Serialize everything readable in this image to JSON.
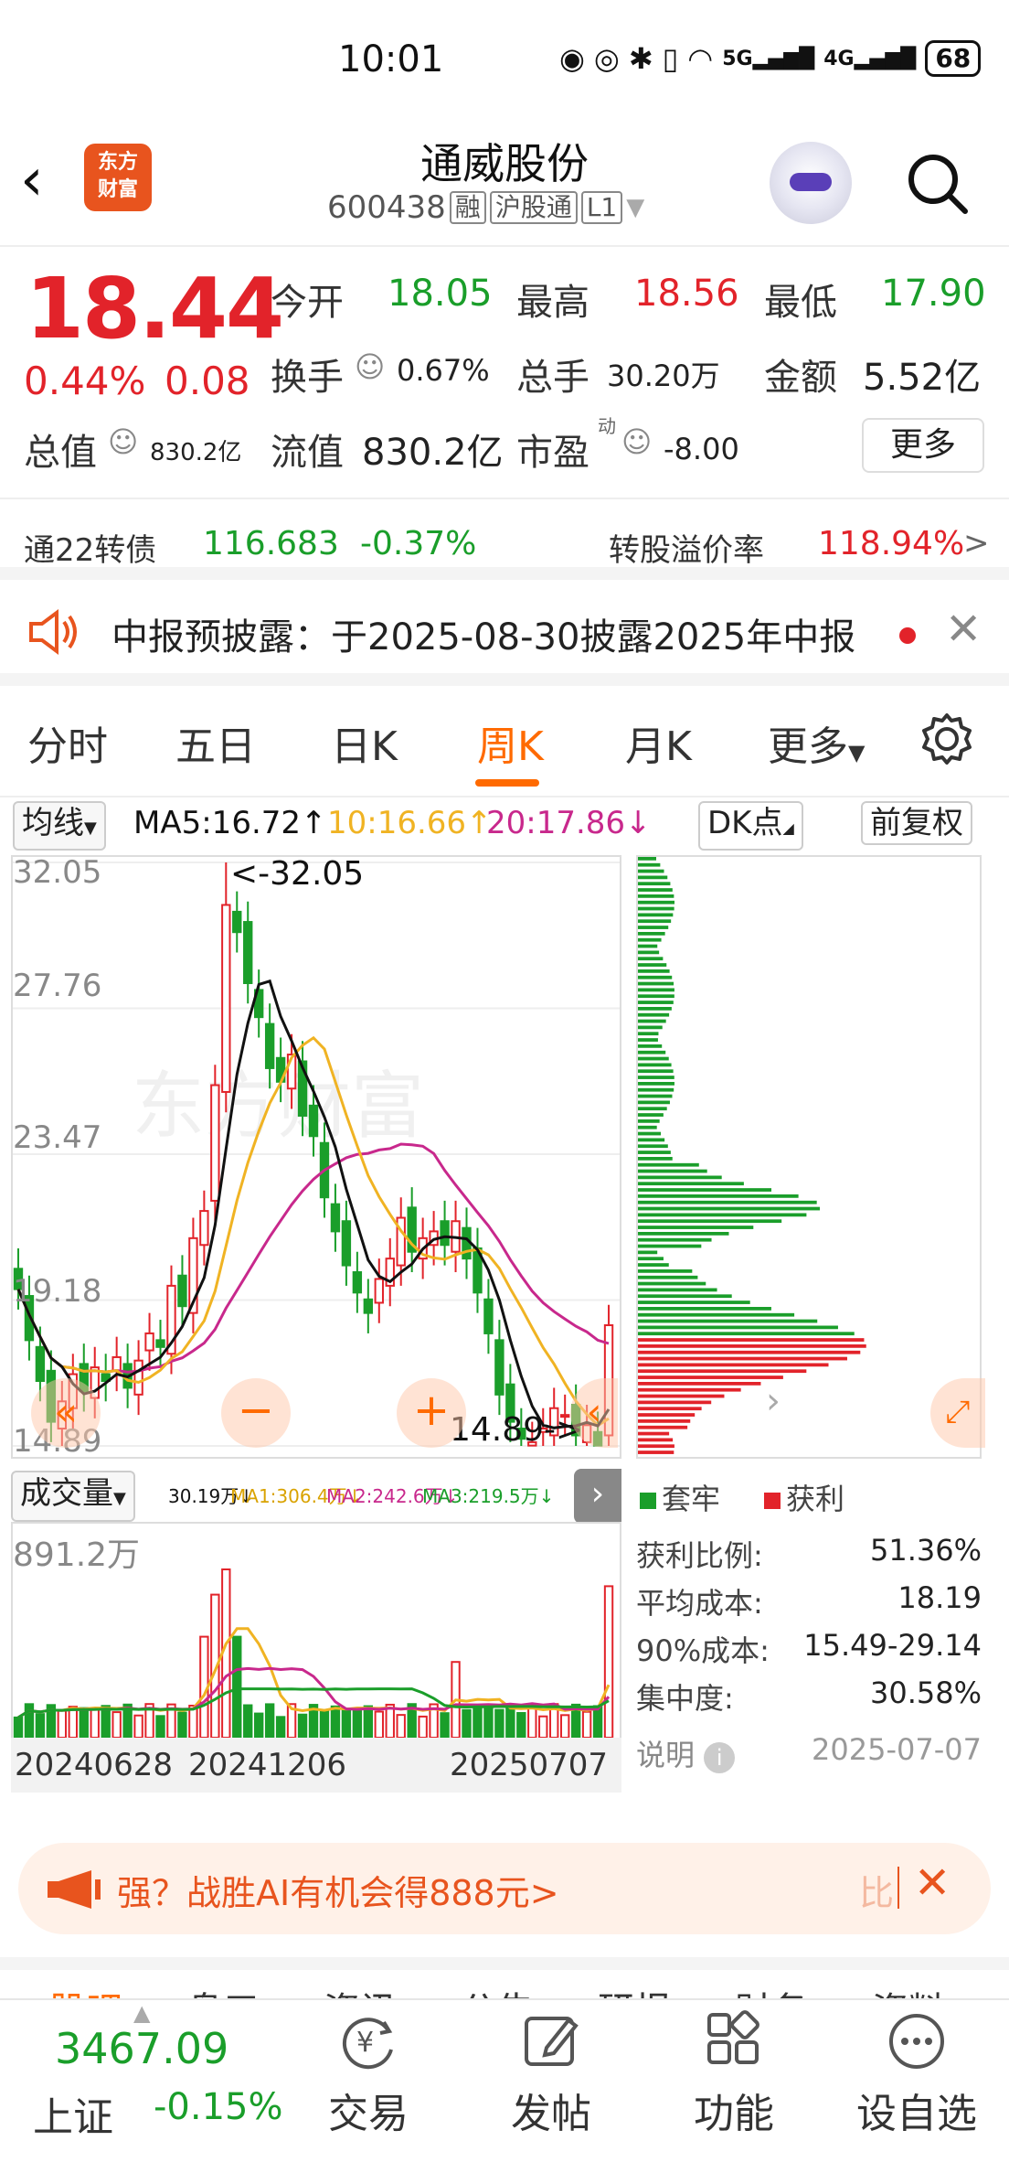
{
  "status_bar": {
    "time": "10:01",
    "network": "5G",
    "network2": "4G",
    "battery": "68"
  },
  "header": {
    "title": "通威股份",
    "code": "600438",
    "tags": [
      "融",
      "沪股通",
      "L1"
    ],
    "logo_text": "东方财富"
  },
  "quote": {
    "price": "18.44",
    "change_pct": "0.44%",
    "change_val": "0.08",
    "open_label": "今开",
    "open": "18.05",
    "high_label": "最高",
    "high": "18.56",
    "low_label": "最低",
    "low": "17.90",
    "turnover_label": "换手",
    "turnover": "0.67%",
    "volume_label": "总手",
    "volume": "30.20万",
    "amount_label": "金额",
    "amount": "5.52亿",
    "total_cap_label": "总值",
    "total_cap": "830.2亿",
    "float_cap_label": "流值",
    "float_cap": "830.2亿",
    "pe_label": "市盈",
    "pe_sup": "动",
    "pe": "-8.00",
    "more_label": "更多"
  },
  "bond": {
    "name": "通22转债",
    "price": "116.683",
    "chg": "-0.37%",
    "premium_label": "转股溢价率",
    "premium": "118.94%",
    "arrow": ">"
  },
  "notice": {
    "text": "中报预披露：于2025-08-30披露2025年中报"
  },
  "tabs": {
    "items": [
      "分时",
      "五日",
      "日K",
      "周K",
      "月K",
      "更多"
    ],
    "active": "周K"
  },
  "ma": {
    "selector": "均线",
    "ma5": "MA5:16.72↑",
    "ma10": "10:16.66↑",
    "ma20": "20:17.86↓",
    "dk": "DK点",
    "adjust": "前复权"
  },
  "kchart": {
    "y_labels": [
      "32.05",
      "27.76",
      "23.47",
      "19.18",
      "14.89"
    ],
    "max_note": "<-32.05",
    "min_note": "14.89->",
    "watermark": "东方财富"
  },
  "volume": {
    "selector": "成交量",
    "vol": "30.19万↓",
    "ma1": "MA1:306.4万↓",
    "ma2": "MA2:242.6万↓",
    "ma3": "MA3:219.5万↓",
    "max": "891.2万",
    "dates": [
      "20240628",
      "20241206",
      "20250707"
    ]
  },
  "chips": {
    "legend_trapped": "套牢",
    "legend_profit": "获利",
    "stats": [
      {
        "label": "获利比例:",
        "value": "51.36%"
      },
      {
        "label": "平均成本:",
        "value": "18.19"
      },
      {
        "label": "90%成本:",
        "value": "15.49-29.14"
      },
      {
        "label": "集中度:",
        "value": "30.58%"
      }
    ],
    "note_label": "说明",
    "date": "2025-07-07"
  },
  "banner": {
    "text": "强？战胜AI有机会得888元>",
    "tail": "比"
  },
  "subtabs": [
    "股吧",
    "盘口",
    "资讯",
    "公告",
    "研报",
    "财务",
    "资料"
  ],
  "bottom_nav": {
    "index_value": "3467.09",
    "index_name": "上证",
    "index_chg": "-0.15%",
    "items": [
      "交易",
      "发帖",
      "功能",
      "设自选"
    ]
  },
  "colors": {
    "up": "#e2232a",
    "down": "#1a9e2a",
    "accent": "#ff6a00",
    "ma5": "#111111",
    "ma10": "#f0b323",
    "ma20": "#c8288c"
  },
  "chart_data": {
    "type": "candlestick",
    "ylim": [
      14.89,
      32.05
    ],
    "closes": [
      19.5,
      18.0,
      16.8,
      15.6,
      16.2,
      17.0,
      16.5,
      17.2,
      16.8,
      17.5,
      16.6,
      17.4,
      18.2,
      17.8,
      19.6,
      19.0,
      21.0,
      21.8,
      25.5,
      30.8,
      30.0,
      28.5,
      27.5,
      26.0,
      25.6,
      26.4,
      24.6,
      24.0,
      22.2,
      21.2,
      20.2,
      19.4,
      18.8,
      19.8,
      20.4,
      21.6,
      20.6,
      21.0,
      21.2,
      20.8,
      21.5,
      20.4,
      19.4,
      18.2,
      16.4,
      15.6,
      15.1,
      15.0,
      15.4,
      16.0,
      15.8,
      15.2,
      15.5,
      14.9,
      18.44
    ],
    "ma_legend": [
      "MA5",
      "MA10",
      "MA20"
    ],
    "volume_max_label": "891.2万",
    "chip_distribution": {
      "trapped_label": "套牢",
      "profit_label": "获利"
    }
  }
}
